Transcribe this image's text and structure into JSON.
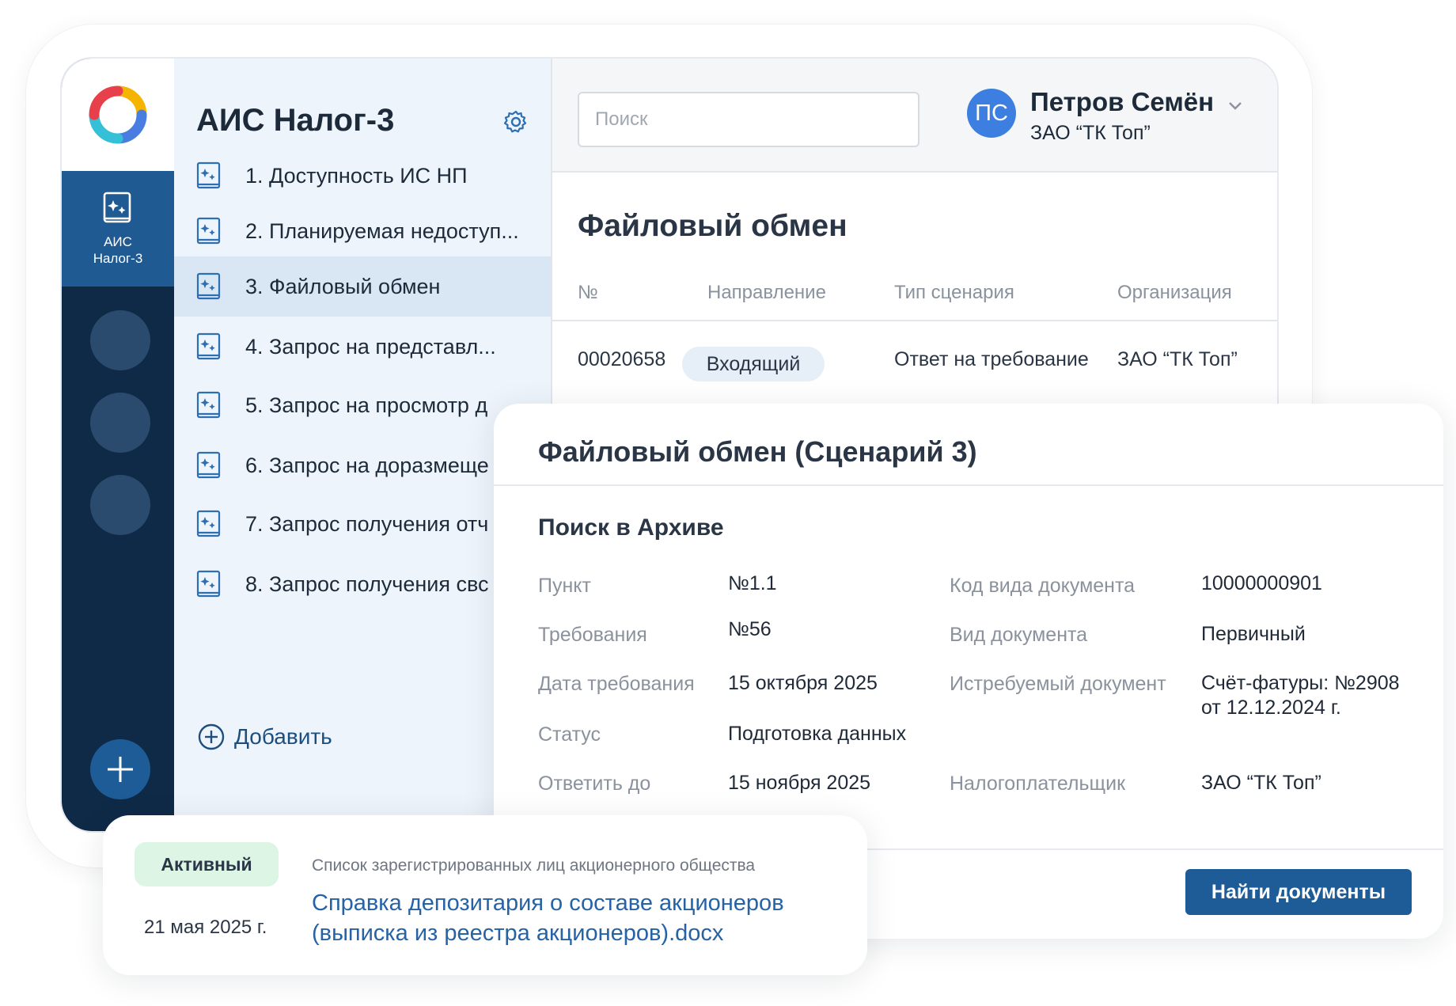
{
  "app": {
    "title": "АИС Налог-3",
    "rail_label": "АИС\nНалог-3",
    "colors": {
      "rail_bg": "#0f2a47",
      "rail_active": "#1f5a92",
      "accent": "#1e5c98",
      "active_row": "#d9e7f4"
    }
  },
  "sidebar": {
    "items": [
      {
        "label": "1. Доступность ИС НП",
        "icon": "document-sparkle-icon"
      },
      {
        "label": "2. Планируемая недоступ...",
        "icon": "document-sparkle-icon"
      },
      {
        "label": "3. Файловый обмен",
        "icon": "document-sparkle-icon",
        "active": true
      },
      {
        "label": "4. Запрос на представл...",
        "icon": "document-sparkle-icon"
      },
      {
        "label": "5. Запрос на просмотр д",
        "icon": "document-sparkle-icon"
      },
      {
        "label": "6. Запрос на доразмеще",
        "icon": "document-sparkle-icon"
      },
      {
        "label": "7. Запрос получения отч",
        "icon": "document-sparkle-icon"
      },
      {
        "label": "8. Запрос получения свс",
        "icon": "document-sparkle-icon"
      }
    ],
    "add_label": "Добавить"
  },
  "header": {
    "search_placeholder": "Поиск",
    "user": {
      "initials": "ПС",
      "name": "Петров Семён",
      "org": "ЗАО “ТК Топ”"
    }
  },
  "main": {
    "title": "Файловый обмен",
    "table": {
      "columns": [
        "№",
        "Направление",
        "Тип сценария",
        "Организация"
      ],
      "rows": [
        {
          "number": "00020658",
          "direction": "Входящий",
          "scenario": "Ответ на требование",
          "org": "ЗАО “ТК Топ”"
        }
      ]
    }
  },
  "detail": {
    "title": "Файловый обмен (Сценарий 3)",
    "section": "Поиск в Архиве",
    "left": [
      {
        "label": "Пункт",
        "value": "№1.1"
      },
      {
        "label": "Требования",
        "value": "№56"
      },
      {
        "label": "Дата требования",
        "value": "15 октября 2025"
      },
      {
        "label": "Статус",
        "value": "Подготовка данных"
      },
      {
        "label": "Ответить до",
        "value": "15 ноября 2025"
      }
    ],
    "right": [
      {
        "label": "Код вида документа",
        "value": "10000000901"
      },
      {
        "label": "Вид документа",
        "value": "Первичный"
      },
      {
        "label": "Истребуемый документ",
        "value": "Счёт-фатуры: №2908\nот 12.12.2024 г."
      },
      {
        "label": "Налогоплательщик",
        "value": "ЗАО “ТК Топ”"
      }
    ],
    "button": "Найти документы"
  },
  "doc_card": {
    "status": "Активный",
    "date": "21 мая 2025 г.",
    "description": "Список зарегистрированных лиц акционерного общества",
    "link": "Справка депозитария о составе акционеров (выписка из реестра акционеров).docx"
  }
}
